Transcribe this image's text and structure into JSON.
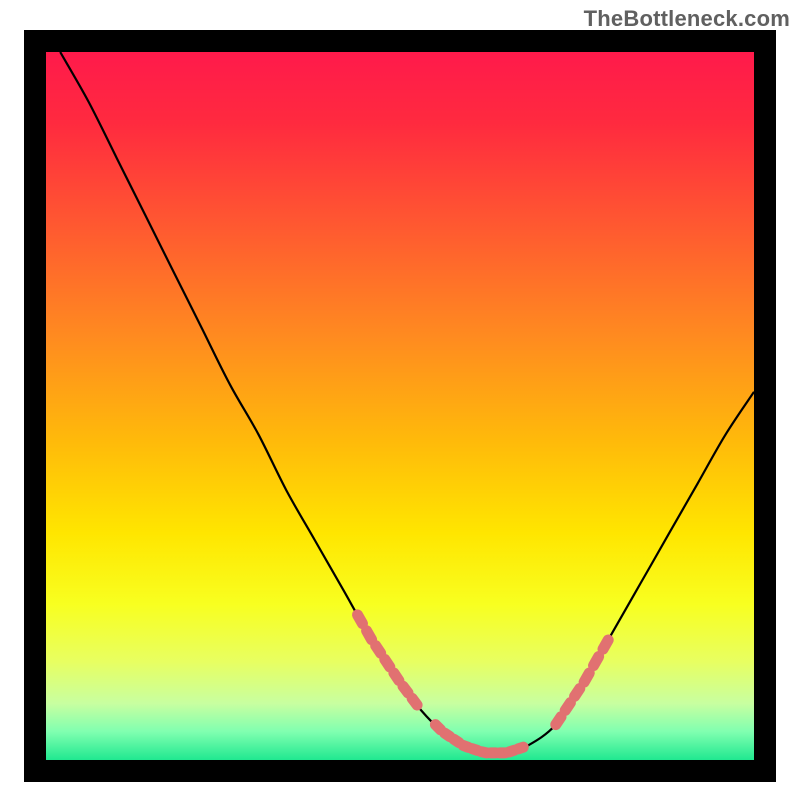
{
  "watermark": "TheBottleneck.com",
  "colors": {
    "frame": "#000000",
    "curve": "#000000",
    "dash": "#e17171",
    "gradient_stops": [
      {
        "offset": 0.0,
        "color": "#ff1a4b"
      },
      {
        "offset": 0.1,
        "color": "#ff2a3f"
      },
      {
        "offset": 0.25,
        "color": "#ff5a30"
      },
      {
        "offset": 0.4,
        "color": "#ff8a20"
      },
      {
        "offset": 0.55,
        "color": "#ffba0a"
      },
      {
        "offset": 0.68,
        "color": "#ffe600"
      },
      {
        "offset": 0.78,
        "color": "#f8ff20"
      },
      {
        "offset": 0.86,
        "color": "#e8ff60"
      },
      {
        "offset": 0.92,
        "color": "#c8ffa0"
      },
      {
        "offset": 0.96,
        "color": "#80ffb0"
      },
      {
        "offset": 1.0,
        "color": "#20e890"
      }
    ]
  },
  "chart_data": {
    "type": "line",
    "title": "",
    "xlabel": "",
    "ylabel": "",
    "xlim": [
      0,
      100
    ],
    "ylim": [
      0,
      100
    ],
    "legend": false,
    "grid": false,
    "series": [
      {
        "name": "bottleneck-curve",
        "x": [
          2,
          6,
          10,
          14,
          18,
          22,
          26,
          30,
          34,
          38,
          42,
          46,
          50,
          53,
          56,
          59,
          62,
          65,
          68,
          72,
          76,
          80,
          84,
          88,
          92,
          96,
          100
        ],
        "y": [
          100,
          93,
          85,
          77,
          69,
          61,
          53,
          46,
          38,
          31,
          24,
          17,
          11,
          7,
          4,
          2,
          1,
          1,
          2,
          5,
          11,
          18,
          25,
          32,
          39,
          46,
          52
        ]
      }
    ],
    "dash_regions": [
      {
        "x0": 44,
        "x1": 53,
        "segments": 7
      },
      {
        "x0": 55,
        "x1": 68,
        "segments": 10
      },
      {
        "x0": 72,
        "x1": 80,
        "segments": 6
      }
    ]
  }
}
